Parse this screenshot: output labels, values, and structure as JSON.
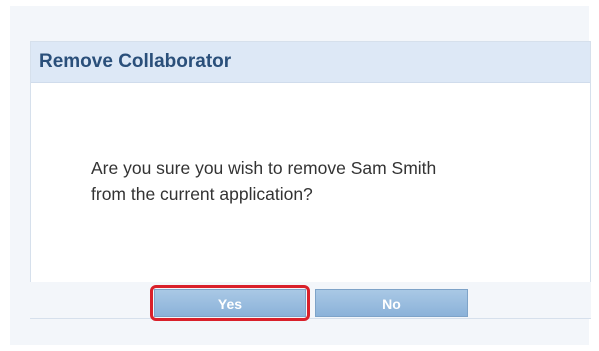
{
  "dialog": {
    "title": "Remove Collaborator",
    "message_line1": "Are you sure you wish to remove Sam Smith",
    "message_line2": "from the current application?"
  },
  "buttons": {
    "yes_label": "Yes",
    "no_label": "No"
  },
  "colors": {
    "header_bg": "#dde8f6",
    "title_text": "#2a4f7a",
    "button_bg": "#8bb2d9",
    "highlight": "#d9202a"
  }
}
